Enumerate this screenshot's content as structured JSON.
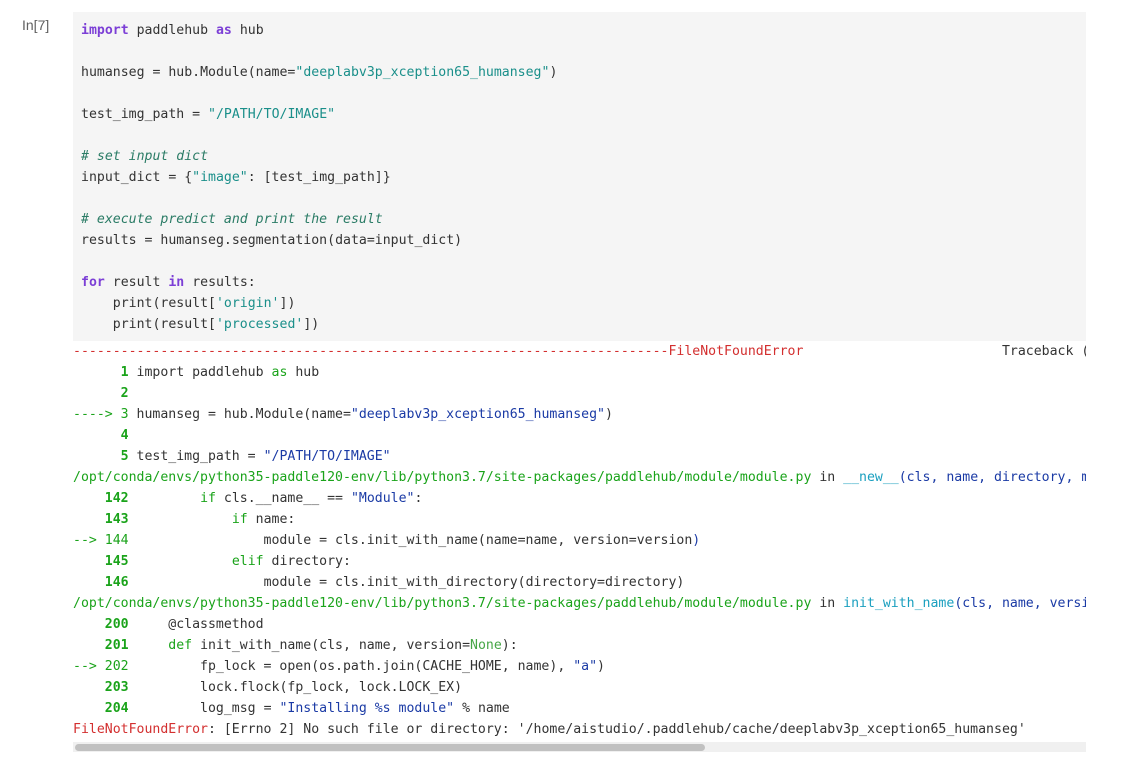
{
  "cell": {
    "prompt": "In[7]",
    "code_lines": [
      [
        {
          "t": "import",
          "c": "kw"
        },
        {
          "t": " paddlehub "
        },
        {
          "t": "as",
          "c": "kw"
        },
        {
          "t": " hub"
        }
      ],
      [],
      [
        {
          "t": "humanseg = hub.Module(name="
        },
        {
          "t": "\"deeplabv3p_xception65_humanseg\"",
          "c": "str"
        },
        {
          "t": ")"
        }
      ],
      [],
      [
        {
          "t": "test_img_path = "
        },
        {
          "t": "\"/PATH/TO/IMAGE\"",
          "c": "str"
        }
      ],
      [],
      [
        {
          "t": "# set input dict",
          "c": "cm"
        }
      ],
      [
        {
          "t": "input_dict = {"
        },
        {
          "t": "\"image\"",
          "c": "str"
        },
        {
          "t": ": [test_img_path]}"
        }
      ],
      [],
      [
        {
          "t": "# execute predict and print the result",
          "c": "cm"
        }
      ],
      [
        {
          "t": "results = humanseg.segmentation(data=input_dict)"
        }
      ],
      [],
      [
        {
          "t": "for",
          "c": "kw"
        },
        {
          "t": " result "
        },
        {
          "t": "in",
          "c": "kw"
        },
        {
          "t": " results:"
        }
      ],
      [
        {
          "t": "    print(result["
        },
        {
          "t": "'origin'",
          "c": "str"
        },
        {
          "t": "])"
        }
      ],
      [
        {
          "t": "    print(result["
        },
        {
          "t": "'processed'",
          "c": "str"
        },
        {
          "t": "])"
        }
      ]
    ]
  },
  "traceback": {
    "lines": [
      [
        {
          "t": "---------------------------------------------------------------------------FileNotFoundError",
          "c": "red"
        },
        {
          "t": "                         Traceback (most recent call last)"
        }
      ],
      [
        {
          "t": "      "
        },
        {
          "t": "1",
          "c": "grn"
        },
        {
          "t": " import paddlehub "
        },
        {
          "t": "as",
          "c": "grnp"
        },
        {
          "t": " hub"
        }
      ],
      [
        {
          "t": "      "
        },
        {
          "t": "2",
          "c": "grn"
        }
      ],
      [
        {
          "t": "----> 3 ",
          "c": "grnp"
        },
        {
          "t": "humanseg = hub.Module(name="
        },
        {
          "t": "\"deeplabv3p_xception65_humanseg\"",
          "c": "blu"
        },
        {
          "t": ")"
        }
      ],
      [
        {
          "t": "      "
        },
        {
          "t": "4",
          "c": "grn"
        }
      ],
      [
        {
          "t": "      "
        },
        {
          "t": "5",
          "c": "grn"
        },
        {
          "t": " test_img_path = "
        },
        {
          "t": "\"/PATH/TO/IMAGE\"",
          "c": "blu"
        }
      ],
      [
        {
          "t": "/opt/conda/envs/python35-paddle120-env/lib/python3.7/site-packages/paddlehub/module/module.py",
          "c": "grnp"
        },
        {
          "t": " in "
        },
        {
          "t": "__new__",
          "c": "cyn"
        },
        {
          "t": "(cls, name, directory, module_dir, version, **kwargs)",
          "c": "blu"
        }
      ],
      [
        {
          "t": "    "
        },
        {
          "t": "142",
          "c": "grn"
        },
        {
          "t": "         "
        },
        {
          "t": "if",
          "c": "grnp"
        },
        {
          "t": " cls.__name__ == "
        },
        {
          "t": "\"Module\"",
          "c": "blu"
        },
        {
          "t": ":"
        }
      ],
      [
        {
          "t": "    "
        },
        {
          "t": "143",
          "c": "grn"
        },
        {
          "t": "             "
        },
        {
          "t": "if",
          "c": "grnp"
        },
        {
          "t": " name:"
        }
      ],
      [
        {
          "t": "--> 144",
          "c": "grnp"
        },
        {
          "t": "                 module = cls.init_with_name(name=name, version=version"
        },
        {
          "t": ")",
          "c": "blu"
        }
      ],
      [
        {
          "t": "    "
        },
        {
          "t": "145",
          "c": "grn"
        },
        {
          "t": "             "
        },
        {
          "t": "elif",
          "c": "grnp"
        },
        {
          "t": " directory:"
        }
      ],
      [
        {
          "t": "    "
        },
        {
          "t": "146",
          "c": "grn"
        },
        {
          "t": "                 module = cls.init_with_directory(directory=directory)"
        }
      ],
      [
        {
          "t": "/opt/conda/envs/python35-paddle120-env/lib/python3.7/site-packages/paddlehub/module/module.py",
          "c": "grnp"
        },
        {
          "t": " in "
        },
        {
          "t": "init_with_name",
          "c": "cyn"
        },
        {
          "t": "(cls, name, version)",
          "c": "blu"
        }
      ],
      [
        {
          "t": "    "
        },
        {
          "t": "200",
          "c": "grn"
        },
        {
          "t": "     @classmethod"
        }
      ],
      [
        {
          "t": "    "
        },
        {
          "t": "201",
          "c": "grn"
        },
        {
          "t": "     "
        },
        {
          "t": "def",
          "c": "grnp"
        },
        {
          "t": " init_with_name(cls, name, version="
        },
        {
          "t": "None",
          "c": "ltg"
        },
        {
          "t": "):"
        }
      ],
      [
        {
          "t": "--> 202",
          "c": "grnp"
        },
        {
          "t": "         fp_lock = open(os.path.join(CACHE_HOME, name), "
        },
        {
          "t": "\"a\"",
          "c": "blu"
        },
        {
          "t": ")"
        }
      ],
      [
        {
          "t": "    "
        },
        {
          "t": "203",
          "c": "grn"
        },
        {
          "t": "         lock.flock(fp_lock, lock.LOCK_EX)"
        }
      ],
      [
        {
          "t": "    "
        },
        {
          "t": "204",
          "c": "grn"
        },
        {
          "t": "         log_msg = "
        },
        {
          "t": "\"Installing %s module\"",
          "c": "blu"
        },
        {
          "t": " % name"
        }
      ],
      [
        {
          "t": "FileNotFoundError",
          "c": "red"
        },
        {
          "t": ": [Errno 2] No such file or directory: '/home/aistudio/.paddlehub/cache/deeplabv3p_xception65_humanseg'"
        }
      ]
    ]
  }
}
